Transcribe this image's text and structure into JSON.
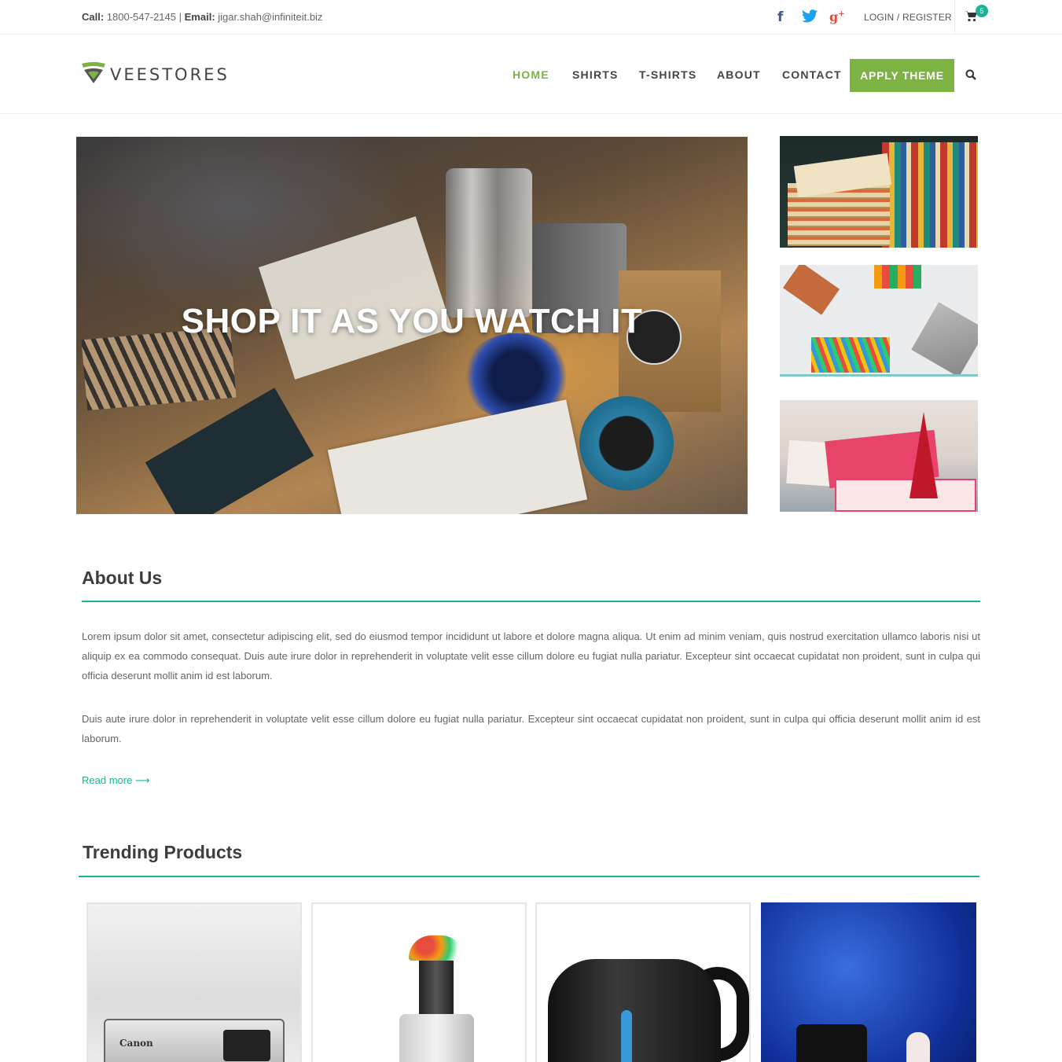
{
  "topbar": {
    "call_label": "Call:",
    "phone": "1800-547-2145",
    "separator": "|",
    "email_label": "Email:",
    "email": "jigar.shah@infiniteit.biz",
    "social": [
      {
        "icon": "facebook-icon",
        "glyph": "f"
      },
      {
        "icon": "twitter-icon",
        "glyph": ""
      },
      {
        "icon": "google-plus-icon",
        "glyph": "g"
      }
    ],
    "login": "LOGIN / REGISTER",
    "cart_count": "5"
  },
  "header": {
    "logo_text": "VEESTORES",
    "nav": [
      {
        "label": "HOME",
        "active": true
      },
      {
        "label": "SHIRTS",
        "active": false
      },
      {
        "label": "T-SHIRTS",
        "active": false
      },
      {
        "label": "ABOUT",
        "active": false
      },
      {
        "label": "CONTACT",
        "active": false
      }
    ],
    "cta": "APPLY THEME"
  },
  "hero": {
    "title": "SHOP IT AS YOU WATCH IT"
  },
  "about": {
    "title": "About Us",
    "para1": "Lorem ipsum dolor sit amet, consectetur adipiscing elit, sed do eiusmod tempor incididunt ut labore et dolore magna aliqua. Ut enim ad minim veniam, quis nostrud exercitation ullamco laboris nisi ut aliquip ex ea commodo consequat. Duis aute irure dolor in reprehenderit in voluptate velit esse cillum dolore eu fugiat nulla pariatur. Excepteur sint occaecat cupidatat non proident, sunt in culpa qui officia deserunt mollit anim id est laborum.",
    "para2": "Duis aute irure dolor in reprehenderit in voluptate velit esse cillum dolore eu fugiat nulla pariatur. Excepteur sint occaecat cupidatat non proident, sunt in culpa qui officia deserunt mollit anim id est laborum.",
    "read_more": "Read more ⟶"
  },
  "trending": {
    "title": "Trending Products",
    "camera_brand": "Canon"
  },
  "colors": {
    "accent_green": "#7cb342",
    "accent_teal": "#1bb394"
  }
}
